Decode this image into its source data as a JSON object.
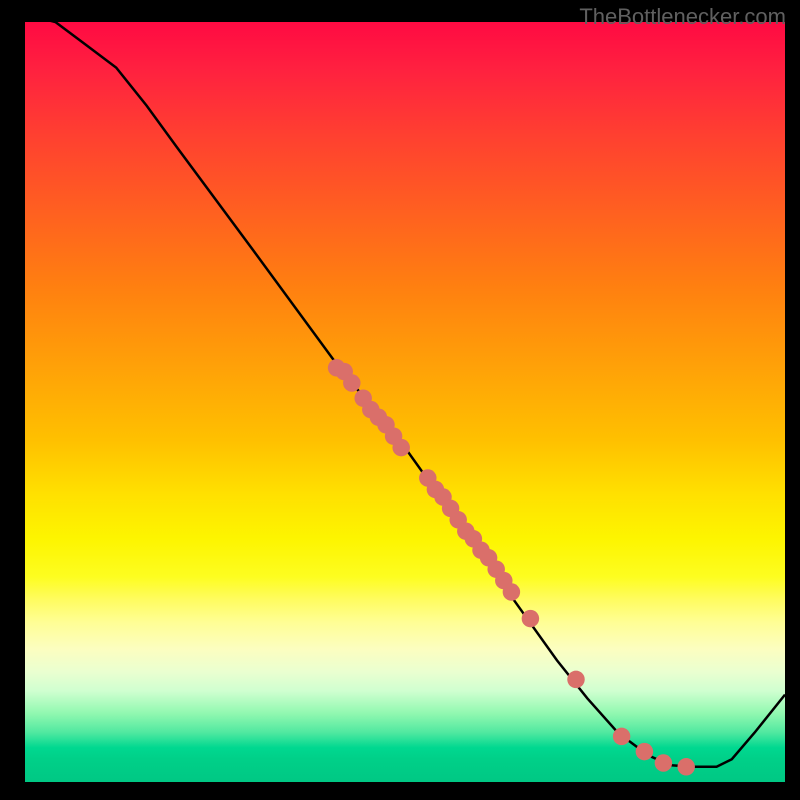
{
  "watermark": "TheBottlenecker.com",
  "chart_data": {
    "type": "line",
    "title": "",
    "xlabel": "",
    "ylabel": "",
    "xlim": [
      0,
      100
    ],
    "ylim": [
      0,
      100
    ],
    "grid": false,
    "background": "rainbow_gradient_vertical",
    "series": [
      {
        "name": "curve",
        "type": "line",
        "color": "#000000",
        "points": [
          {
            "x": 0,
            "y": 101
          },
          {
            "x": 4,
            "y": 100
          },
          {
            "x": 8,
            "y": 97
          },
          {
            "x": 12,
            "y": 94
          },
          {
            "x": 16,
            "y": 89
          },
          {
            "x": 20,
            "y": 83.5
          },
          {
            "x": 30,
            "y": 70
          },
          {
            "x": 41,
            "y": 55
          },
          {
            "x": 50,
            "y": 44
          },
          {
            "x": 55,
            "y": 37
          },
          {
            "x": 60,
            "y": 30
          },
          {
            "x": 65,
            "y": 23
          },
          {
            "x": 70,
            "y": 16
          },
          {
            "x": 74,
            "y": 11
          },
          {
            "x": 78,
            "y": 6.5
          },
          {
            "x": 82,
            "y": 3.5
          },
          {
            "x": 85,
            "y": 2.2
          },
          {
            "x": 88,
            "y": 2
          },
          {
            "x": 91,
            "y": 2
          },
          {
            "x": 93,
            "y": 3
          },
          {
            "x": 96,
            "y": 6.5
          },
          {
            "x": 100,
            "y": 11.5
          }
        ]
      },
      {
        "name": "dots",
        "type": "scatter",
        "color": "#da6f6a",
        "points": [
          {
            "x": 41,
            "y": 54.5
          },
          {
            "x": 42,
            "y": 54
          },
          {
            "x": 43,
            "y": 52.5
          },
          {
            "x": 44.5,
            "y": 50.5
          },
          {
            "x": 45.5,
            "y": 49
          },
          {
            "x": 46.5,
            "y": 48
          },
          {
            "x": 47.5,
            "y": 47
          },
          {
            "x": 48.5,
            "y": 45.5
          },
          {
            "x": 49.5,
            "y": 44
          },
          {
            "x": 53,
            "y": 40
          },
          {
            "x": 54,
            "y": 38.5
          },
          {
            "x": 55,
            "y": 37.5
          },
          {
            "x": 56,
            "y": 36
          },
          {
            "x": 57,
            "y": 34.5
          },
          {
            "x": 58,
            "y": 33
          },
          {
            "x": 59,
            "y": 32
          },
          {
            "x": 60,
            "y": 30.5
          },
          {
            "x": 61,
            "y": 29.5
          },
          {
            "x": 62,
            "y": 28
          },
          {
            "x": 63,
            "y": 26.5
          },
          {
            "x": 64,
            "y": 25
          },
          {
            "x": 66.5,
            "y": 21.5
          },
          {
            "x": 72.5,
            "y": 13.5
          },
          {
            "x": 78.5,
            "y": 6
          },
          {
            "x": 81.5,
            "y": 4
          },
          {
            "x": 84,
            "y": 2.5
          },
          {
            "x": 87,
            "y": 2
          }
        ]
      }
    ]
  }
}
